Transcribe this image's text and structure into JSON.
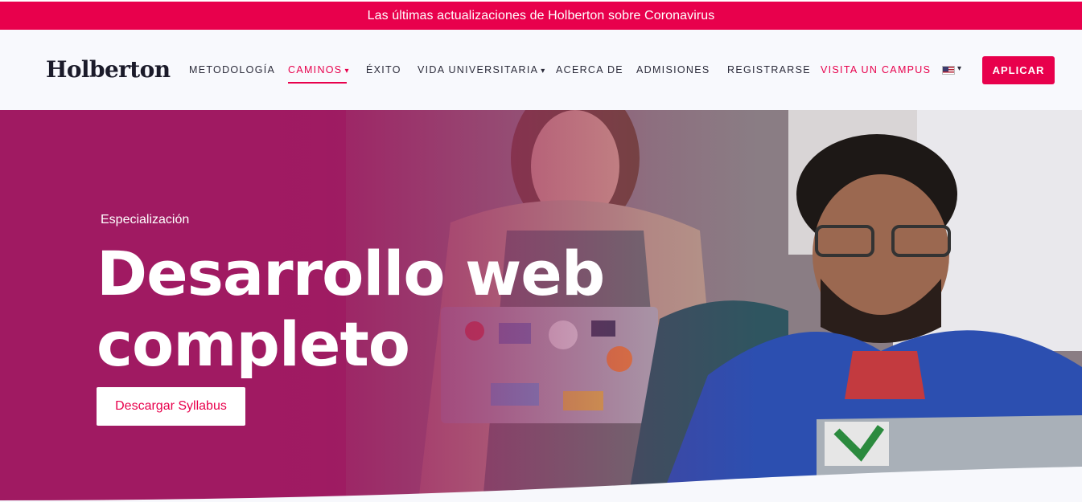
{
  "banner": {
    "text": "Las últimas actualizaciones de Holberton sobre Coronavirus"
  },
  "header": {
    "logo": "Holberton",
    "nav": [
      {
        "label": "METODOLOGÍA"
      },
      {
        "label": "CAMINOS",
        "has_caret": true,
        "active": true
      },
      {
        "label": "ÉXITO"
      },
      {
        "label": "VIDA UNIVERSITARIA",
        "has_caret": true
      },
      {
        "label": "ACERCA DE"
      },
      {
        "label": "ADMISIONES"
      },
      {
        "label": "REGISTRARSE"
      },
      {
        "label": "VISITA UN CAMPUS"
      }
    ],
    "caret_glyph": "▾",
    "language_icon": "us-flag-icon",
    "apply_label": "APLICAR"
  },
  "hero": {
    "eyebrow": "Especialización",
    "title": "Desarrollo web completo",
    "cta_label": "Descargar Syllabus"
  },
  "colors": {
    "accent": "#e8004c",
    "hero_tint": "#a01a62",
    "text_dark": "#2b2b3a"
  }
}
